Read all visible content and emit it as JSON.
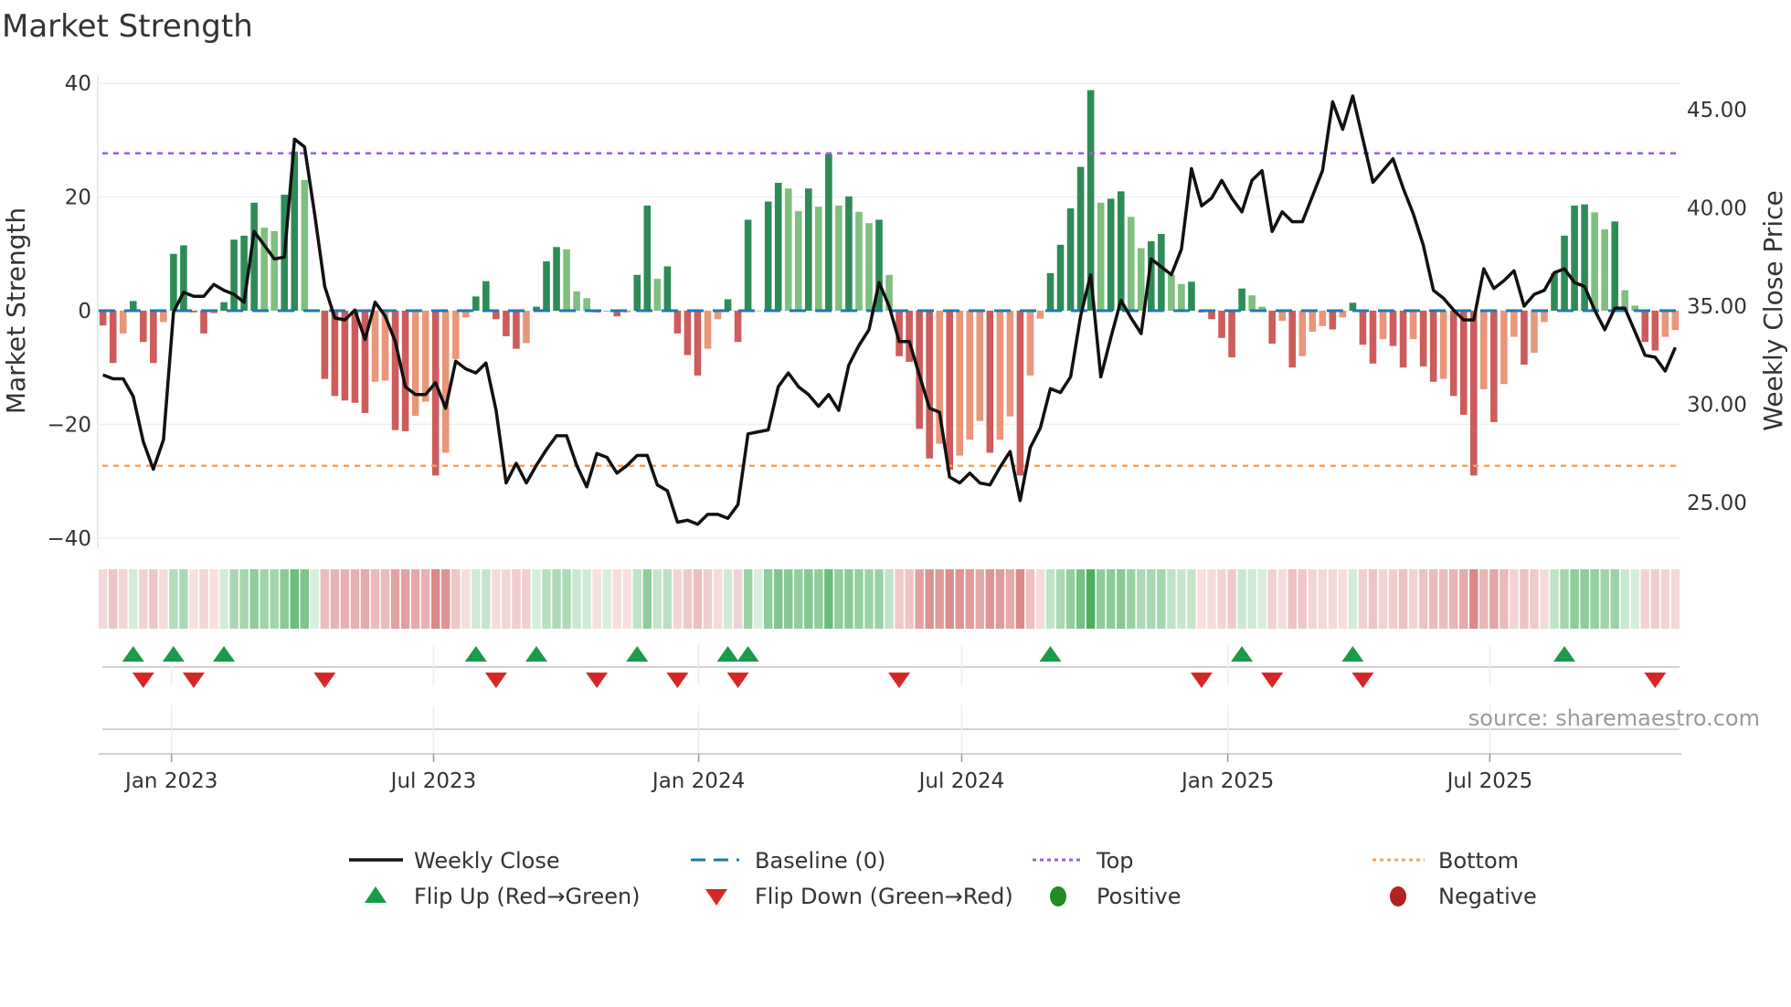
{
  "title": "Market Strength",
  "source": "source: sharemaestro.com",
  "legend": {
    "weekly_close": "Weekly Close",
    "baseline": "Baseline (0)",
    "top": "Top",
    "bottom": "Bottom",
    "flip_up": "Flip Up (Red→Green)",
    "flip_down": "Flip Down (Green→Red)",
    "positive": "Positive",
    "negative": "Negative"
  },
  "chart_data": {
    "type": "bar",
    "title": "Market Strength",
    "ylabel": "Market Strength",
    "y2label": "Weekly Close Price",
    "ylim": [
      -42,
      42
    ],
    "y2lim": [
      22.8,
      46.9
    ],
    "yticks": [
      "40",
      "20",
      "0",
      "−20",
      "−40"
    ],
    "ytick_values": [
      40,
      20,
      0,
      -20,
      -40
    ],
    "y2ticks": [
      "45.00",
      "40.00",
      "35.00",
      "30.00",
      "25.00"
    ],
    "y2tick_values": [
      45,
      40,
      35,
      30,
      25
    ],
    "xticks": [
      {
        "label": "Jan 2023",
        "week_index": 6.8
      },
      {
        "label": "Jul 2023",
        "week_index": 32.8
      },
      {
        "label": "Jan 2024",
        "week_index": 59.1
      },
      {
        "label": "Jul 2024",
        "week_index": 85.2
      },
      {
        "label": "Jan 2025",
        "week_index": 111.6
      },
      {
        "label": "Jul 2025",
        "week_index": 137.6
      }
    ],
    "top_threshold": 27.7,
    "bottom_threshold": -27.3,
    "baseline": 0,
    "strength": [
      -2.6,
      -9.2,
      -4,
      1.7,
      -5.5,
      -9.2,
      -2,
      10,
      11.5,
      -0.3,
      -4,
      -0.5,
      1.5,
      12.5,
      13.2,
      19,
      14.6,
      14,
      20.4,
      28,
      23,
      0,
      -12,
      -15,
      -15.8,
      -16.2,
      -18,
      -12.5,
      -12.3,
      -21,
      -21.2,
      -18.5,
      -16,
      -29,
      -25,
      -8.5,
      -1.2,
      2.5,
      5.2,
      -1.5,
      -4.5,
      -6.7,
      -5.7,
      0.7,
      8.7,
      11.2,
      10.8,
      3.4,
      2.2,
      -0.3,
      0,
      -1,
      -0.3,
      6.3,
      18.5,
      5.6,
      7.8,
      -4,
      -7.8,
      -11.4,
      -6.7,
      -1.5,
      2,
      -5.5,
      16,
      0,
      19.2,
      22.5,
      21.5,
      17.5,
      21.5,
      18.3,
      27.6,
      18.5,
      20.1,
      17.4,
      15.4,
      16,
      6.3,
      -8,
      -9,
      -20.8,
      -26,
      -23.4,
      -28,
      -25.5,
      -22.7,
      -19.4,
      -25,
      -22.7,
      -18.6,
      -29,
      -11.4,
      -1.4,
      6.6,
      11.6,
      18,
      25.3,
      38.8,
      19,
      19.7,
      21,
      16.5,
      11,
      12.2,
      13.5,
      6.3,
      4.7,
      5.1,
      -0.3,
      -1.5,
      -4.8,
      -8.2,
      3.9,
      2.7,
      0.7,
      -5.8,
      -1.8,
      -10,
      -8,
      -3.7,
      -2.7,
      -3.3,
      -1.2,
      1.4,
      -6,
      -9.3,
      -5,
      -6.2,
      -10,
      -5,
      -9.8,
      -12.5,
      -12,
      -15,
      -18.3,
      -29,
      -13.8,
      -19.6,
      -12.9,
      -4.6,
      -9.5,
      -7.4,
      -2,
      6.6,
      13.2,
      18.5,
      18.7,
      17.3,
      14.3,
      15.7,
      3.6,
      0.9,
      -5.5,
      -7,
      -4.6,
      -3.4
    ],
    "weekly_close": [
      31.5,
      31.3,
      31.3,
      30.4,
      28.1,
      26.7,
      28.2,
      34.7,
      35.7,
      35.5,
      35.5,
      36.1,
      35.8,
      35.6,
      35.2,
      38.8,
      38.1,
      37.4,
      37.5,
      43.5,
      43.1,
      39.7,
      36.0,
      34.4,
      34.3,
      34.8,
      33.3,
      35.2,
      34.5,
      33.2,
      30.9,
      30.5,
      30.5,
      31.1,
      29.8,
      32.2,
      31.8,
      31.6,
      32.1,
      29.7,
      26.0,
      27.0,
      26.0,
      26.9,
      27.7,
      28.4,
      28.4,
      26.9,
      25.8,
      27.5,
      27.3,
      26.5,
      26.9,
      27.4,
      27.4,
      25.9,
      25.6,
      24.0,
      24.1,
      23.9,
      24.4,
      24.4,
      24.2,
      24.9,
      28.5,
      28.6,
      28.7,
      30.9,
      31.6,
      30.9,
      30.5,
      29.9,
      30.5,
      29.7,
      32.0,
      33.0,
      33.8,
      36.2,
      35.0,
      33.2,
      33.2,
      31.5,
      29.8,
      29.6,
      26.3,
      26.0,
      26.5,
      26.0,
      25.9,
      26.8,
      27.6,
      25.1,
      27.8,
      28.8,
      30.8,
      30.6,
      31.4,
      34.5,
      36.6,
      31.4,
      33.4,
      35.3,
      34.4,
      33.6,
      37.4,
      37.0,
      36.6,
      37.9,
      42.0,
      40.1,
      40.5,
      41.4,
      40.5,
      39.8,
      41.4,
      41.9,
      38.8,
      39.8,
      39.3,
      39.3,
      40.6,
      41.9,
      45.4,
      44.0,
      45.7,
      43.5,
      41.3,
      41.9,
      42.5,
      41.0,
      39.7,
      38.1,
      35.8,
      35.4,
      34.8,
      34.3,
      34.3,
      36.9,
      35.9,
      36.3,
      36.8,
      35.0,
      35.6,
      35.8,
      36.7,
      36.9,
      36.2,
      36.0,
      34.8,
      33.8,
      34.9,
      34.9,
      33.7,
      32.5,
      32.4,
      31.7,
      32.9
    ],
    "flip_up_weeks": [
      3,
      7,
      12,
      37,
      43,
      53,
      62,
      64,
      94,
      113,
      124,
      145
    ],
    "flip_down_weeks": [
      4,
      9,
      22,
      39,
      49,
      57,
      63,
      79,
      109,
      116,
      125,
      154
    ],
    "colors": {
      "pos_strong": "#2e8b57",
      "pos_weak": "#7fbf7f",
      "neg_strong": "#cd5c5c",
      "neg_weak": "#e9967a",
      "close": "#111111",
      "baseline": "#1f77b4",
      "top": "#9b5de5",
      "bottom": "#f4a261",
      "flip_up": "#1a9a4a",
      "flip_down": "#d62728",
      "positive": "#228b22",
      "negative": "#b22222"
    }
  }
}
